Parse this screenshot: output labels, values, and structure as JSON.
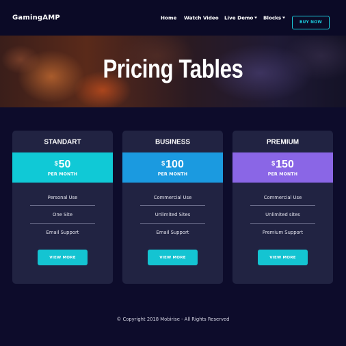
{
  "nav": {
    "brand": "GamingAMP",
    "items": [
      {
        "label": "Home"
      },
      {
        "label": "Watch Video"
      },
      {
        "label": "Live Demo"
      },
      {
        "label": "Blocks"
      }
    ],
    "buy_label": "BUY NOW"
  },
  "hero": {
    "title": "Pricing Tables"
  },
  "plans": [
    {
      "name": "STANDART",
      "currency": "$",
      "amount": "50",
      "period": "PER MONTH",
      "features": [
        "Personal Use",
        "One Site",
        "Email Support"
      ],
      "button": "VIEW MORE",
      "band_color": "#10c9d6"
    },
    {
      "name": "BUSINESS",
      "currency": "$",
      "amount": "100",
      "period": "PER MONTH",
      "features": [
        "Commercial Use",
        "Unlimited Sites",
        "Email Support"
      ],
      "button": "VIEW MORE",
      "band_color": "#1b9ae0"
    },
    {
      "name": "PREMIUM",
      "currency": "$",
      "amount": "150",
      "period": "PER MONTH",
      "features": [
        "Commercial Use",
        "Unlimited sites",
        "Premium Support"
      ],
      "button": "VIEW MORE",
      "band_color": "#8a66e6"
    }
  ],
  "footer": {
    "text": "© Copyright 2018 Mobirise - All Rights Reserved"
  },
  "colors": {
    "background": "#0d0c2b",
    "card": "#212342",
    "accent": "#1ccfe0"
  }
}
